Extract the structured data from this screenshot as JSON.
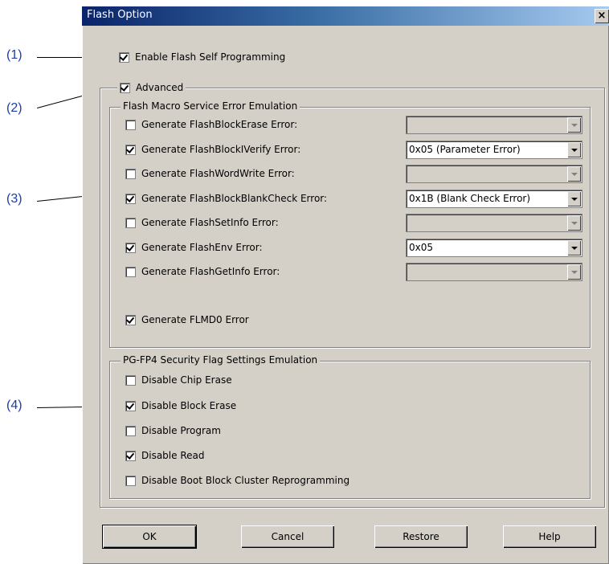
{
  "callouts": [
    "(1)",
    "(2)",
    "(3)",
    "(4)"
  ],
  "window": {
    "title": "Flash Option",
    "close_glyph": "×"
  },
  "enable_self_programming": {
    "label": "Enable Flash Self Programming",
    "checked": true
  },
  "advanced": {
    "label": "Advanced",
    "checked": true
  },
  "fms_group": {
    "title": "Flash Macro Service Error Emulation",
    "items": [
      {
        "label": "Generate FlashBlockErase Error:",
        "checked": false,
        "combo": "",
        "enabled": false
      },
      {
        "label": "Generate FlashBlockIVerify Error:",
        "checked": true,
        "combo": "0x05 (Parameter Error)",
        "enabled": true
      },
      {
        "label": "Generate FlashWordWrite Error:",
        "checked": false,
        "combo": "",
        "enabled": false
      },
      {
        "label": "Generate FlashBlockBlankCheck Error:",
        "checked": true,
        "combo": "0x1B (Blank Check Error)",
        "enabled": true
      },
      {
        "label": "Generate FlashSetInfo Error:",
        "checked": false,
        "combo": "",
        "enabled": false
      },
      {
        "label": "Generate FlashEnv Error:",
        "checked": true,
        "combo": "0x05",
        "enabled": true
      },
      {
        "label": "Generate FlashGetInfo Error:",
        "checked": false,
        "combo": "",
        "enabled": false
      }
    ],
    "flmd0": {
      "label": "Generate FLMD0 Error",
      "checked": true
    }
  },
  "security_group": {
    "title": "PG-FP4 Security Flag Settings Emulation",
    "items": [
      {
        "label": "Disable Chip Erase",
        "checked": false
      },
      {
        "label": "Disable Block Erase",
        "checked": true
      },
      {
        "label": "Disable Program",
        "checked": false
      },
      {
        "label": "Disable Read",
        "checked": true
      },
      {
        "label": "Disable Boot Block Cluster Reprogramming",
        "checked": false
      }
    ]
  },
  "buttons": {
    "ok": "OK",
    "cancel": "Cancel",
    "restore": "Restore",
    "help": "Help"
  }
}
